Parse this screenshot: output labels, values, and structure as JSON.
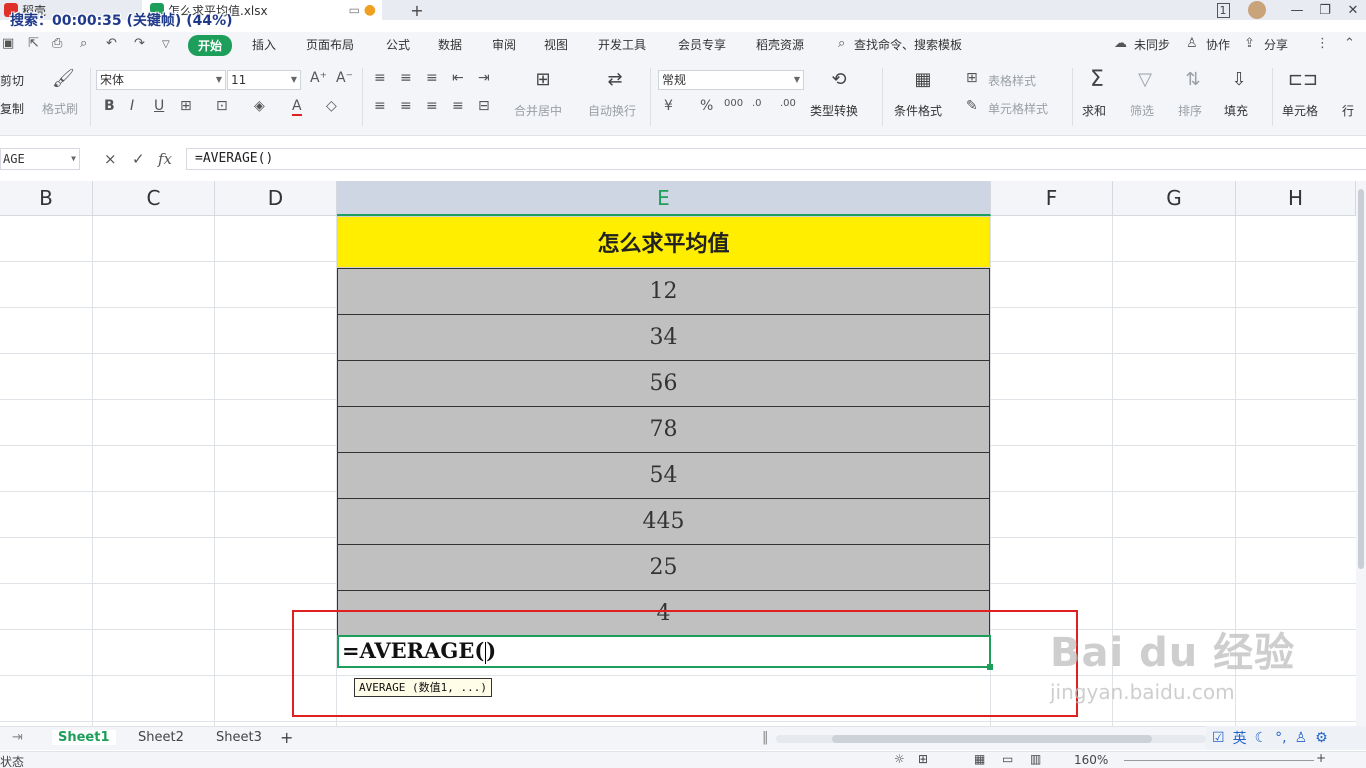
{
  "titlebar": {
    "tabs": [
      {
        "label": "稻壳"
      },
      {
        "label": "怎么求平均值.xlsx"
      }
    ],
    "overlay_text": "搜索：00:00:35 (关键帧) (44%)",
    "add_tab": "+",
    "page_indicator": "1"
  },
  "menubar": {
    "items": [
      "开始",
      "插入",
      "页面布局",
      "公式",
      "数据",
      "审阅",
      "视图",
      "开发工具",
      "会员专享",
      "稻壳资源"
    ],
    "search": "查找命令、搜索模板",
    "unsynced": "未同步",
    "collab": "协作",
    "share": "分享"
  },
  "ribbon": {
    "cut": "剪切",
    "copy": "复制",
    "format_painter": "格式刷",
    "font_name": "宋体",
    "font_size": "11",
    "merge_center": "合并居中",
    "auto_wrap": "自动换行",
    "number_format": "常规",
    "type_convert": "类型转换",
    "cond_format": "条件格式",
    "table_style": "表格样式",
    "cell_style": "单元格样式",
    "sum": "求和",
    "filter": "筛选",
    "sort": "排序",
    "fill": "填充",
    "cell": "单元格",
    "row": "行"
  },
  "formulabar": {
    "name_box": "AGE",
    "cancel": "×",
    "confirm": "✓",
    "fx": "fx",
    "formula": "=AVERAGE()"
  },
  "sheet": {
    "columns": [
      "B",
      "C",
      "D",
      "E",
      "F",
      "G",
      "H"
    ],
    "header_cell": "怎么求平均值",
    "values": [
      "12",
      "34",
      "56",
      "78",
      "54",
      "445",
      "25",
      "4"
    ],
    "editing_text": "=AVERAGE(",
    "editing_text_after": ")",
    "tooltip": "AVERAGE (数值1, ...)"
  },
  "watermark": {
    "brand": "Bai du 经验",
    "url": "jingyan.baidu.com"
  },
  "tabs": {
    "sheets": [
      "Sheet1",
      "Sheet2",
      "Sheet3"
    ],
    "add": "+",
    "ime": "英"
  },
  "statusbar": {
    "status": "状态",
    "zoom": "160%"
  }
}
